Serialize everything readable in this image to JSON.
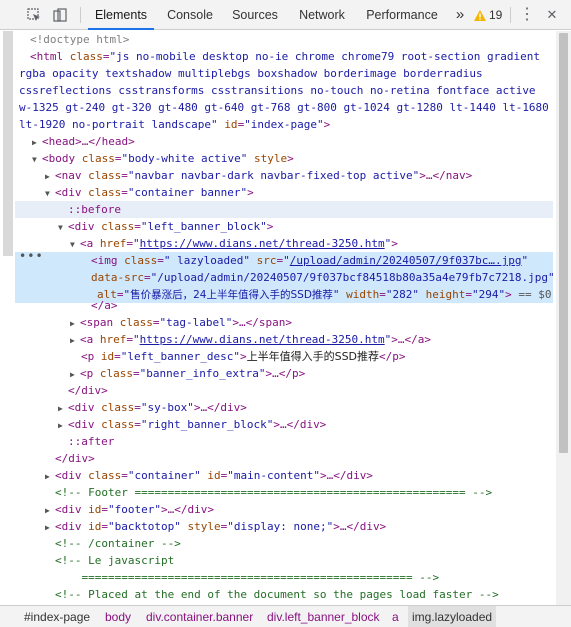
{
  "toolbar": {
    "tabs": [
      "Elements",
      "Console",
      "Sources",
      "Network",
      "Performance"
    ],
    "more_tabs": "»",
    "warning_count": "19",
    "kebab": "⋮",
    "close": "✕"
  },
  "dom": {
    "doctype": "<!doctype html>",
    "html_open_1": "<html ",
    "html_class_attr": "class",
    "html_class_val_1": "\"js no-mobile desktop no-ie chrome chrome79 root-section gradient",
    "html_class_val_2": "rgba opacity textshadow multiplebgs boxshadow borderimage borderradius",
    "html_class_val_3": "cssreflections csstransforms csstransitions no-touch no-retina fontface active",
    "html_class_val_4": "w-1325 gt-240 gt-320 gt-480 gt-640 gt-768 gt-800 gt-1024 gt-1280 lt-1440 lt-1680",
    "html_class_val_5a": "lt-1920 no-portrait landscape\"",
    "html_id_attr": "id",
    "html_id_val": "\"index-page\"",
    "head": "<head>…</head>",
    "body_open": "<body ",
    "body_class_val": "\"body-white active\"",
    "body_style_attr": "style",
    "nav_open": "<nav ",
    "nav_class_val": "\"navbar navbar-dark navbar-fixed-top active\"",
    "nav_rest": ">…</nav>",
    "div_banner_class_val": "\"container banner\"",
    "before": "::before",
    "div_left_class_val": "\"left_banner_block\"",
    "a_href_attr": "href",
    "a_href_val": "https://www.dians.net/thread-3250.htm",
    "img_open": "<img ",
    "img_class_val": "\" lazyloaded\"",
    "img_src_attr": "src",
    "img_src_val": "/upload/admin/20240507/9f037bc….jpg",
    "img_datasrc_attr": "data-src",
    "img_datasrc_val": "\"/upload/admin/20240507/9f037bcf84518b80a35a4e79fb7c7218.jpg\"",
    "img_alt_attr": "alt",
    "img_alt_val": "售价暴涨后，24上半年值得入手的SSD推荐",
    "img_width_attr": "width",
    "img_width_val": "\"282\"",
    "img_height_attr": "height",
    "img_height_val": "\"294\"",
    "img_dollar": " == $0",
    "a_close": "</a>",
    "span_class_val": "\"tag-label\"",
    "span_rest": ">…</span>",
    "a2_rest": ">…</a>",
    "p_id_val": "\"left_banner_desc\"",
    "p_text": "上半年值得入手的SSD推荐",
    "p2_class_val": "\"banner_info_extra\"",
    "p2_rest": ">…</p>",
    "div_close": "</div>",
    "sybox_class_val": "\"sy-box\"",
    "div_rest": ">…</div>",
    "right_class_val": "\"right_banner_block\"",
    "after": "::after",
    "main_class_val": "\"container\"",
    "main_id_val": "\"main-content\"",
    "footer_comment": "<!-- Footer ================================================== -->",
    "footer_id_val": "\"footer\"",
    "backtotop_id_val": "\"backtotop\"",
    "backtotop_style_val": "\"display: none;\"",
    "container_comment": "<!-- /container -->",
    "js_comment_1": "<!-- Le javascript",
    "js_comment_2": "    ================================================== -->",
    "placed_comment": "<!-- Placed at the end of the document so the pages load faster -->",
    "class_attr": "class",
    "id_attr": "id",
    "style_attr": "style"
  },
  "breadcrumbs": [
    "#index-page",
    "body",
    "div.container.banner",
    "div.left_banner_block",
    "a",
    "img.lazyloaded"
  ]
}
